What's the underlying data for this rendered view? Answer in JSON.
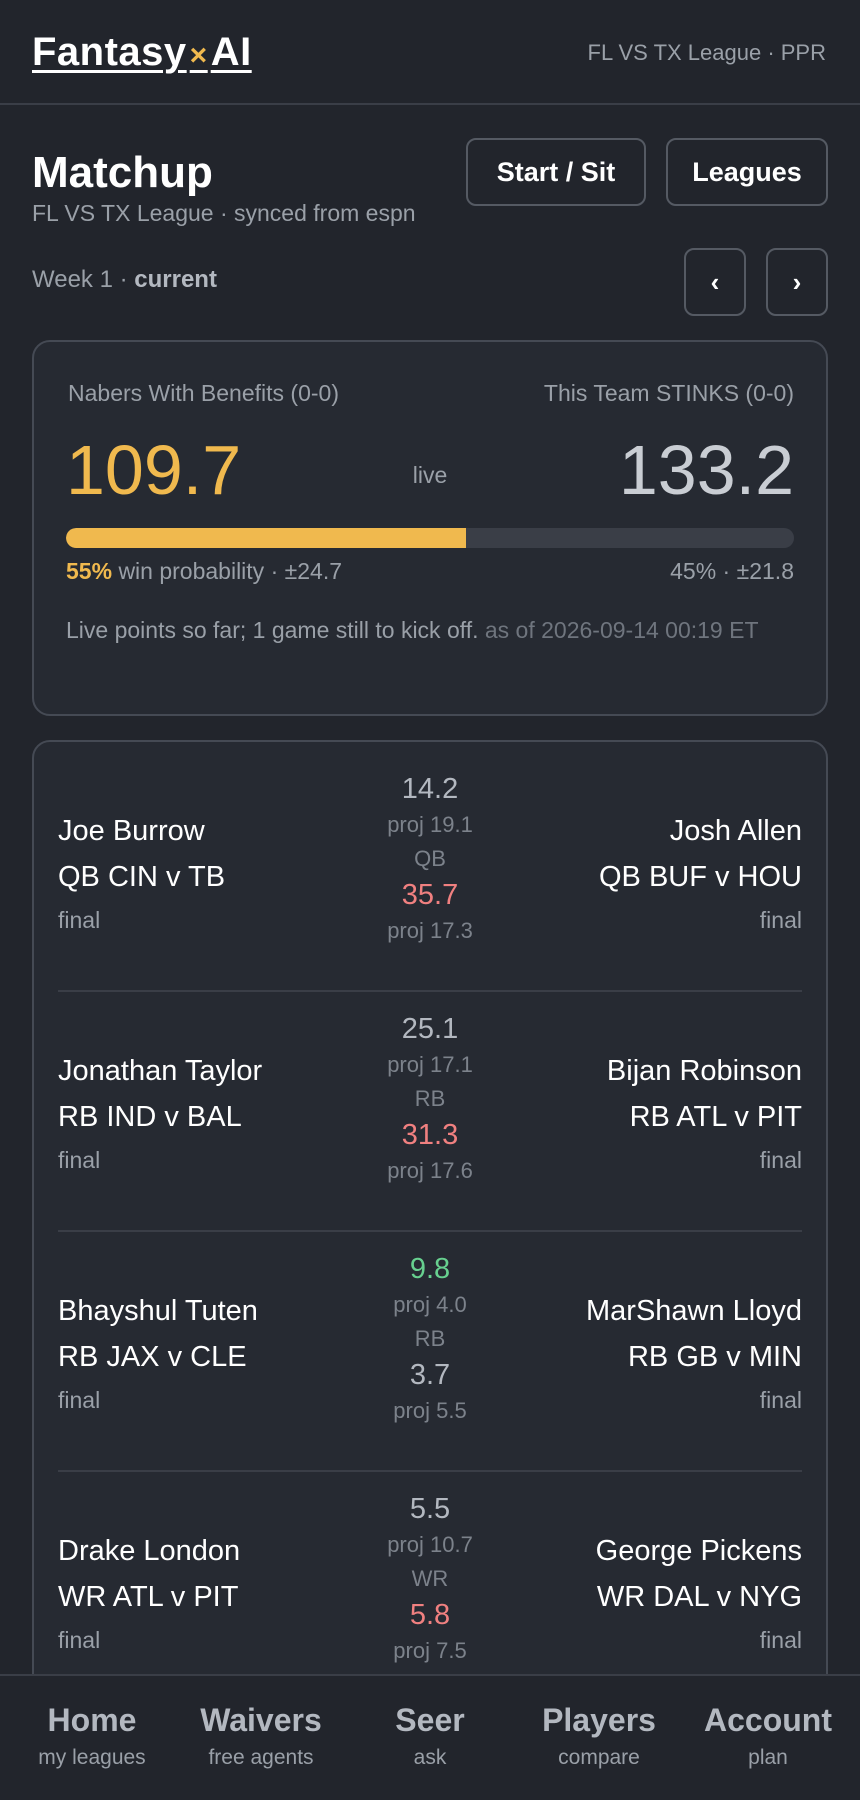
{
  "brand": {
    "part1": "Fantasy",
    "sep": "×",
    "part2": "AI"
  },
  "header": {
    "league_meta": "FL VS TX League · PPR"
  },
  "page": {
    "title": "Matchup",
    "subtitle": "FL VS TX League · synced from espn",
    "start_sit_label": "Start / Sit",
    "leagues_label": "Leagues",
    "week_prefix": "Week 1 ·",
    "week_status": "current",
    "prev_label": "‹",
    "next_label": "›"
  },
  "matchup": {
    "team_left": "Nabers With Benefits (0-0)",
    "team_right": "This Team STINKS (0-0)",
    "score_left": "109.7",
    "score_right": "133.2",
    "live_label": "live",
    "win_prob_left": 0.55,
    "prob_left_pct": "55%",
    "prob_left_text": "win probability · ±24.7",
    "prob_right_text": "45% · ±21.8",
    "note": "Live points so far; 1 game still to kick off.",
    "as_of": "as of 2026-09-14 00:19 ET",
    "accent": "#f0b94e"
  },
  "roster": [
    {
      "left_name": "Joe Burrow",
      "left_info": "QB CIN v TB",
      "left_status": "final",
      "left_score": "14.2",
      "left_proj": "proj 19.1",
      "pos": "QB",
      "right_score": "35.7",
      "right_proj": "proj 17.3",
      "right_name": "Josh Allen",
      "right_info": "QB BUF v HOU",
      "right_status": "final"
    },
    {
      "left_name": "Jonathan Taylor",
      "left_info": "RB IND v BAL",
      "left_status": "final",
      "left_score": "25.1",
      "left_proj": "proj 17.1",
      "pos": "RB",
      "right_score": "31.3",
      "right_proj": "proj 17.6",
      "right_name": "Bijan Robinson",
      "right_info": "RB ATL v PIT",
      "right_status": "final"
    },
    {
      "left_name": "Bhayshul Tuten",
      "left_info": "RB JAX v CLE",
      "left_status": "final",
      "left_score": "9.8",
      "left_proj": "proj 4.0",
      "pos": "RB",
      "right_score": "3.7",
      "right_proj": "proj 5.5",
      "right_name": "MarShawn Lloyd",
      "right_info": "RB GB v MIN",
      "right_status": "final"
    },
    {
      "left_name": "Drake London",
      "left_info": "WR ATL v PIT",
      "left_status": "final",
      "left_score": "5.5",
      "left_proj": "proj 10.7",
      "pos": "WR",
      "right_score": "5.8",
      "right_proj": "proj 7.5",
      "right_name": "George Pickens",
      "right_info": "WR DAL v NYG",
      "right_status": "final"
    }
  ],
  "bottom_nav": [
    {
      "label": "Home",
      "sub": "my leagues"
    },
    {
      "label": "Waivers",
      "sub": "free agents"
    },
    {
      "label": "Seer",
      "sub": "ask"
    },
    {
      "label": "Players",
      "sub": "compare"
    },
    {
      "label": "Account",
      "sub": "plan"
    }
  ]
}
